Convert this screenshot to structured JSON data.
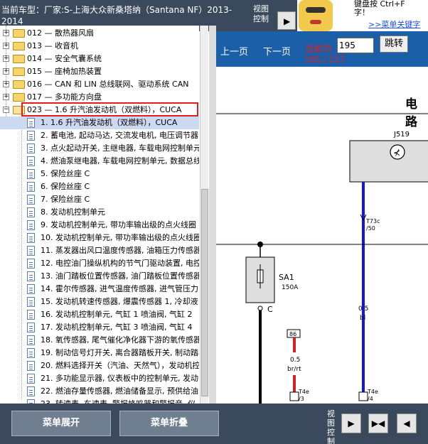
{
  "header": {
    "car_title": "当前车型：厂家:S-上海大众新桑塔纳（Santana NF）2013-2014",
    "view_control": "视图控制"
  },
  "ad": {
    "line1": "键盘按 Ctrl+F",
    "line2": "字！",
    "link": ">>菜单关键字"
  },
  "tree": {
    "folders_top": [
      "012 — 散热器风扇",
      "013 — 收音机",
      "014 — 安全气囊系统",
      "015 — 座椅加热装置",
      "016 — CAN 和 LIN 总线联网、驱动系统 CAN",
      "017 — 多功能方向盘"
    ],
    "open_folder": "023 — 1.6 升汽油发动机（双燃料），CUCA",
    "items": [
      "1. 1.6 升汽油发动机（双燃料），CUCA",
      "2. 蓄电池, 起动马达, 交流发电机, 电压调节器",
      "3. 点火起动开关, 主继电器, 车载电网控制单元",
      "4. 燃油泵继电器, 车载电网控制单元, 数据总线",
      "5. 保险丝座 C",
      "6. 保险丝座 C",
      "7. 保险丝座 C",
      "8. 发动机控制单元",
      "9. 发动机控制单元, 带功率输出级的点火线圈",
      "10. 发动机控制单元, 带功率输出级的点火线圈",
      "11. 蒸发器出风口温度传感器, 油箱压力传感器",
      "12. 电控油门操纵机构的节气门驱动装置, 电控",
      "13. 油门踏板位置传感器, 油门踏板位置传感器",
      "14. 霍尔传感器, 进气温度传感器, 进气管压力",
      "15. 发动机转速传感器, 爆震传感器 1, 冷却液",
      "16. 发动机控制单元, 气缸 1 喷油阀, 气缸 2",
      "17. 发动机控制单元, 气缸 3 喷油阀, 气缸 4",
      "18. 氧传感器, 尾气催化净化器下游的氧传感器",
      "19. 制动信号灯开关, 离合器踏板开关, 制动踏板",
      "20. 燃料选择开关（汽油、天然气），发动机控",
      "21. 多功能显示器, 仪表板中的控制单元, 发动",
      "22. 燃油存量传感器, 燃油储备显示, 预供给油",
      "23. 转速表, 车速表, 警报蜂鸣器和警报音, 仪"
    ]
  },
  "viewer": {
    "prev_label": "上一页",
    "next_label": "下一页",
    "current_label": "当前为",
    "page_value": "195",
    "jump_label": "跳转",
    "page_count": "195 / 217",
    "heading": "电路"
  },
  "diagram": {
    "j519": "J519",
    "connector_top": "T73c",
    "connector_top_pin": "/50",
    "wire_blue_size": "0.5",
    "wire_blue_color": "bl",
    "sa1": "SA1",
    "sa1_rating": "150A",
    "node_c": "C",
    "badge_86": "86",
    "wire_red_size": "0.5",
    "wire_red_color": "br/rt",
    "t4e_left": "T4e",
    "t4e_left_pin": "/3",
    "t4e_right": "T4e",
    "t4e_right_pin": "/4",
    "colors": {
      "blue_wire": "#1414e6",
      "red_wire": "#d42020",
      "black_wire": "#000000"
    }
  },
  "bottom": {
    "expand_label": "菜单展开",
    "collapse_label": "菜单折叠",
    "view_control": "视图控制"
  }
}
